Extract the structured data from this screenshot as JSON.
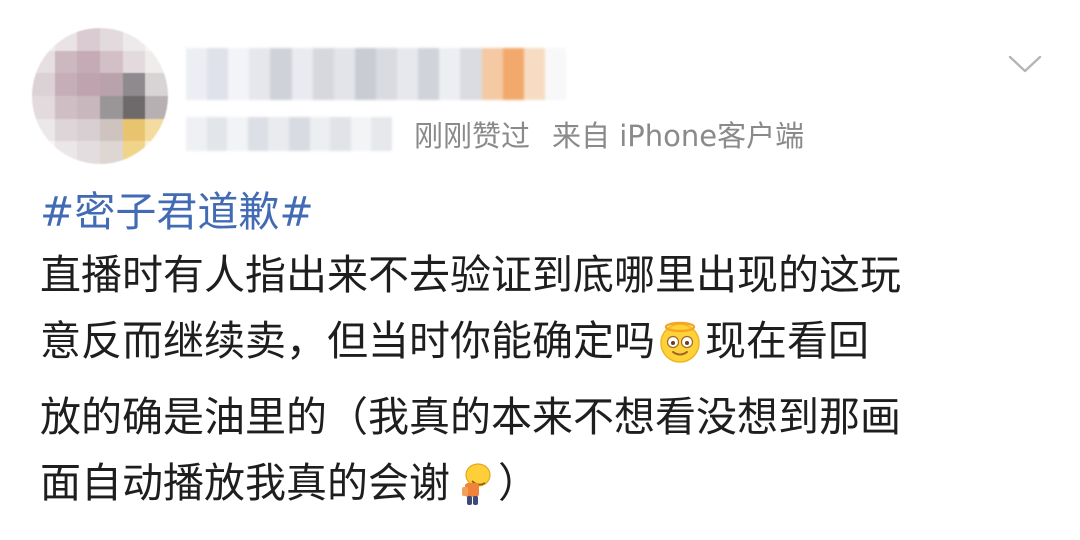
{
  "post": {
    "meta": {
      "liked_label": "刚刚赞过",
      "source_label": "来自 iPhone客户端"
    },
    "hashtag": "#密子君道歉#",
    "body_lines": {
      "line1": "直播时有人指出来不去验证到底哪里出现的这玩",
      "line2_a": "意反而继续卖，但当时你能确定吗",
      "line2_b": "现在看回",
      "line3": "放的确是油里的（我真的本来不想看没想到那画",
      "line4_a": "面自动播放我真的会谢",
      "line4_b": "）"
    },
    "emojis": {
      "first": "smiling-halo-emoji-icon",
      "second": "bowing-person-emoji-icon"
    }
  },
  "icons": {
    "menu": "chevron-down-icon"
  },
  "colors": {
    "hashtag": "#426bb4",
    "body_text": "#1e1e1e",
    "meta_text": "#8a8a8a",
    "background": "#ffffff"
  }
}
